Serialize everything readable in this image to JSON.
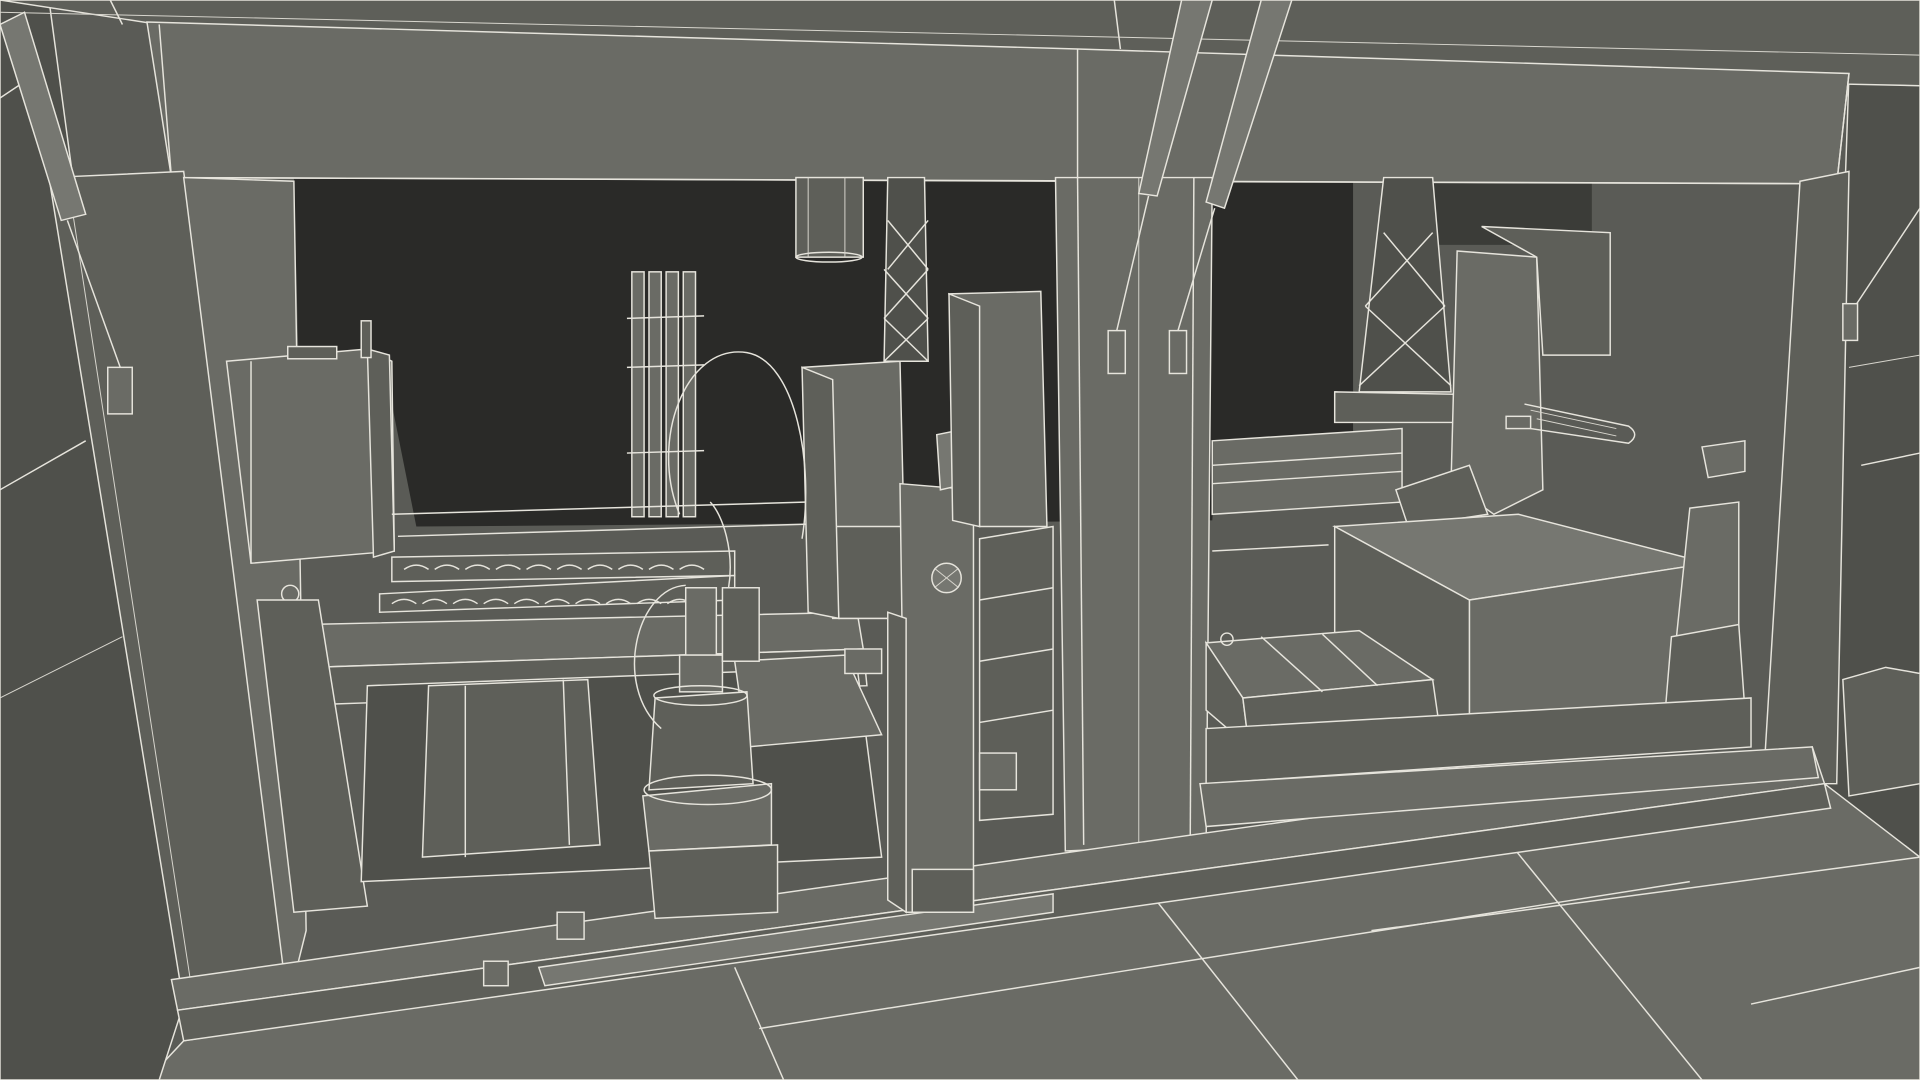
{
  "scene": {
    "subject": "wireframe-render-industrial-machine-enclosure",
    "colors": {
      "background": "#5a5b56",
      "opening": "#2a2a28",
      "wire": "#e6e4dc",
      "surface_dark": "#4f504b",
      "surface_mid": "#5e5f59",
      "surface_light": "#6a6b65"
    }
  }
}
